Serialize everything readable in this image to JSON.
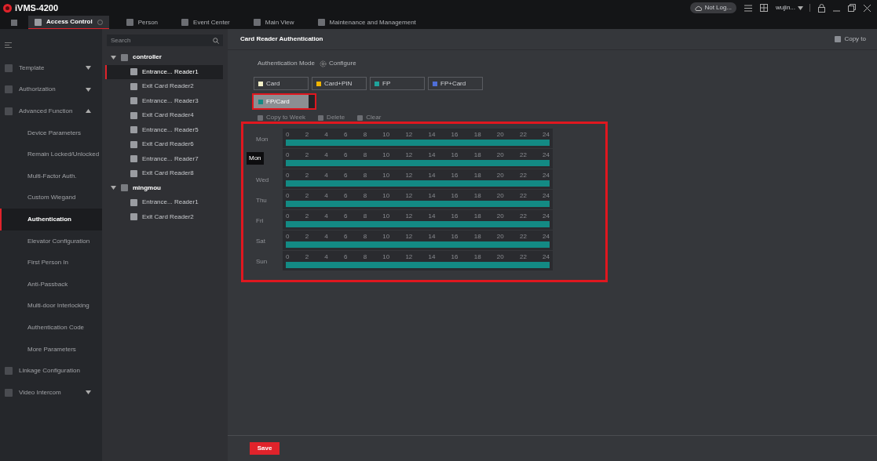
{
  "window": {
    "title": "iVMS-4200",
    "cloud_status": "Not Log...",
    "user": "wujin..."
  },
  "tabs": [
    {
      "label": "Access Control",
      "selected": true
    },
    {
      "label": "Person",
      "selected": false
    },
    {
      "label": "Event Center",
      "selected": false
    },
    {
      "label": "Main View",
      "selected": false
    },
    {
      "label": "Maintenance and Management",
      "selected": false
    }
  ],
  "sidebar": {
    "items": [
      {
        "label": "Template",
        "kind": "group",
        "expanded": false,
        "selected": false
      },
      {
        "label": "Authorization",
        "kind": "group",
        "expanded": false,
        "selected": false
      },
      {
        "label": "Advanced Function",
        "kind": "group",
        "expanded": true,
        "selected": false,
        "children": [
          {
            "label": "Device Parameters",
            "selected": false
          },
          {
            "label": "Remain Locked/Unlocked",
            "selected": false
          },
          {
            "label": "Multi-Factor Auth.",
            "selected": false
          },
          {
            "label": "Custom Wiegand",
            "selected": false
          },
          {
            "label": "Authentication",
            "selected": true
          },
          {
            "label": "Elevator Configuration",
            "selected": false
          },
          {
            "label": "First Person In",
            "selected": false
          },
          {
            "label": "Anti-Passback",
            "selected": false
          },
          {
            "label": "Multi-door Interlocking",
            "selected": false
          },
          {
            "label": "Authentication Code",
            "selected": false
          },
          {
            "label": "More Parameters",
            "selected": false
          }
        ]
      },
      {
        "label": "Linkage Configuration",
        "kind": "link",
        "selected": false
      },
      {
        "label": "Video Intercom",
        "kind": "group",
        "expanded": false,
        "selected": false
      }
    ]
  },
  "device_tree": {
    "search": {
      "placeholder": "Search"
    },
    "devices": [
      {
        "label": "controller",
        "expanded": true,
        "children": [
          {
            "label": "Entrance... Reader1",
            "selected": true
          },
          {
            "label": "Exit Card Reader2",
            "selected": false
          },
          {
            "label": "Entrance... Reader3",
            "selected": false
          },
          {
            "label": "Exit Card Reader4",
            "selected": false
          },
          {
            "label": "Entrance... Reader5",
            "selected": false
          },
          {
            "label": "Exit Card Reader6",
            "selected": false
          },
          {
            "label": "Entrance... Reader7",
            "selected": false
          },
          {
            "label": "Exit Card Reader8",
            "selected": false
          }
        ]
      },
      {
        "label": "mingmou",
        "expanded": true,
        "children": [
          {
            "label": "Entrance... Reader1",
            "selected": false
          },
          {
            "label": "Exit Card Reader2",
            "selected": false
          }
        ]
      }
    ]
  },
  "content": {
    "title": "Card Reader Authentication",
    "copy_to": "Copy to",
    "mode_label": "Authentication Mode",
    "configure": "Configure",
    "modes": [
      {
        "label": "Card",
        "color": "#f2f0c8",
        "selected": false,
        "highlighted": false
      },
      {
        "label": "Card+PIN",
        "color": "#f0b400",
        "selected": false,
        "highlighted": false
      },
      {
        "label": "FP",
        "color": "#1fa39b",
        "selected": false,
        "highlighted": false
      },
      {
        "label": "FP+Card",
        "color": "#4f6fd8",
        "selected": false,
        "highlighted": false
      },
      {
        "label": "FP/Card",
        "color": "#138a84",
        "selected": true,
        "highlighted": true
      }
    ],
    "toolbar": [
      "Copy to Week",
      "Delete",
      "Clear"
    ],
    "schedule": {
      "highlighted": true,
      "rows": [
        {
          "day": "Mon",
          "level": 1,
          "ticks": [
            "0",
            "2",
            "4",
            "6",
            "8",
            "10",
            "12",
            "14",
            "16",
            "18",
            "20",
            "22",
            "24"
          ]
        },
        {
          "level": 1,
          "tooltip": "Mon",
          "ticks": [
            "0",
            "2",
            "4",
            "6",
            "8",
            "10",
            "12",
            "14",
            "16",
            "18",
            "20",
            "22",
            "24"
          ]
        },
        {
          "day": "Wed",
          "level": 1,
          "ticks": [
            "0",
            "2",
            "4",
            "6",
            "8",
            "10",
            "12",
            "14",
            "16",
            "18",
            "20",
            "22",
            "24"
          ]
        },
        {
          "day": "Thu",
          "level": 1,
          "ticks": [
            "0",
            "2",
            "4",
            "6",
            "8",
            "10",
            "12",
            "14",
            "16",
            "18",
            "20",
            "22",
            "24"
          ]
        },
        {
          "day": "Fri",
          "level": 1,
          "ticks": [
            "0",
            "2",
            "4",
            "6",
            "8",
            "10",
            "12",
            "14",
            "16",
            "18",
            "20",
            "22",
            "24"
          ]
        },
        {
          "day": "Sat",
          "level": 1,
          "ticks": [
            "0",
            "2",
            "4",
            "6",
            "8",
            "10",
            "12",
            "14",
            "16",
            "18",
            "20",
            "22",
            "24"
          ]
        },
        {
          "day": "Sun",
          "level": 1,
          "ticks": [
            "0",
            "2",
            "4",
            "6",
            "8",
            "10",
            "12",
            "14",
            "16",
            "18",
            "20",
            "22",
            "24"
          ]
        }
      ]
    },
    "save": "Save"
  }
}
